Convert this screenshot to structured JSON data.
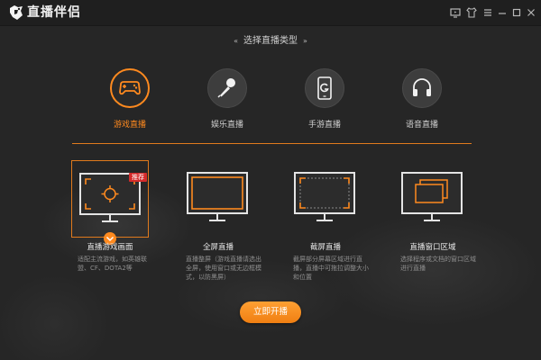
{
  "app": {
    "name": "直播伴侣",
    "window_controls": [
      "monitor-icon",
      "shirt-icon",
      "menu-icon",
      "minimize-icon",
      "maximize-icon",
      "close-icon"
    ]
  },
  "header": {
    "deco_left": "«",
    "title": "选择直播类型",
    "deco_right": "»"
  },
  "types": [
    {
      "label": "游戏直播",
      "icon": "gamepad-icon",
      "active": true
    },
    {
      "label": "娱乐直播",
      "icon": "microphone-icon",
      "active": false
    },
    {
      "label": "手游直播",
      "icon": "phone-icon",
      "active": false
    },
    {
      "label": "语音直播",
      "icon": "headphones-icon",
      "active": false
    }
  ],
  "modes": [
    {
      "title": "直播游戏画面",
      "desc": "适配主流游戏，如英雄联盟、CF、DOTA2等",
      "icon": "target-monitor-icon",
      "badge": "推荐",
      "selected": true
    },
    {
      "title": "全屏直播",
      "desc": "直播整屏（游戏直播请选出全屏，使用窗口或无边框模式，以防黑屏）",
      "icon": "fullscreen-monitor-icon",
      "selected": false
    },
    {
      "title": "截屏直播",
      "desc": "截屏部分屏幕区域进行直播，直播中可拖拉调整大小和位置",
      "icon": "crop-monitor-icon",
      "selected": false
    },
    {
      "title": "直播窗口区域",
      "desc": "选择程序或文档的窗口区域进行直播",
      "icon": "window-monitor-icon",
      "selected": false
    }
  ],
  "start_button": "立即开播",
  "colors": {
    "accent": "#ff8a1f",
    "background": "#262626",
    "titlebar": "#1f1f1f",
    "badge": "#d42b2b"
  }
}
